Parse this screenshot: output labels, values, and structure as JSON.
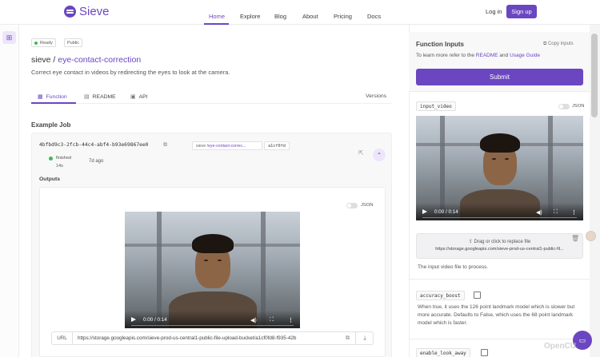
{
  "nav": {
    "brand": "Sieve",
    "links": [
      "Home",
      "Explore",
      "Blog",
      "About",
      "Pricing",
      "Docs"
    ],
    "active_link": "Home",
    "login": "Log in",
    "signup": "Sign up"
  },
  "function": {
    "status_badge": "Ready",
    "visibility_badge": "Public",
    "owner": "sieve /",
    "name": "eye-contact-correction",
    "description": "Correct eye contact in videos by redirecting the eyes to look at the camera.",
    "tabs": [
      {
        "label": "Function",
        "icon": "calendar-icon"
      },
      {
        "label": "README",
        "icon": "file-icon"
      },
      {
        "label": "API",
        "icon": "terminal-icon"
      }
    ],
    "versions_label": "Versions"
  },
  "example_job": {
    "section_title": "Example Job",
    "job_id": "4bfbd9c3-2fcb-44c4-abf4-b93e69867ee0",
    "chip_owner": "sieve / ",
    "chip_function": "eye-contact-correc...",
    "chip_hash": "a1cf0fd",
    "status": "finished",
    "duration": "14s",
    "time_ago": "7d ago",
    "outputs_label": "Outputs",
    "json_toggle_label": "JSON",
    "video_time": "0:00 / 0:14",
    "url_label": "URL",
    "url_value": "https://storage.googleapis.com/sieve-prod-us-central1-public-file-upload-bucket/a1cf0fd8-f935-42b"
  },
  "inputs_panel": {
    "title": "Function Inputs",
    "copy_inputs": "Copy inputs",
    "subtitle_prefix": "To learn more refer to the ",
    "readme_link": "README",
    "subtitle_and": " and ",
    "guide_link": "Usage Guide",
    "submit_label": "Submit",
    "input_video": {
      "name": "input_video",
      "json_label": "JSON",
      "video_time": "0:00 / 0:14",
      "drop_text": "Drag or click to replace file",
      "file_url": "https://storage.googleapis.com/sieve-prod-us-central1-public-fil...",
      "description": "The input video file to process."
    },
    "accuracy_boost": {
      "name": "accuracy_boost",
      "description": "When true, it uses the 126 point landmark model which is slower but more accurate. Defaults to False, which uses the 68 point landmark model which is faster.",
      "checked": false
    },
    "next_param_partial": "enable_look_away"
  },
  "colors": {
    "accent": "#6b46c1",
    "success": "#3fb950"
  },
  "watermark": "OpenCU"
}
